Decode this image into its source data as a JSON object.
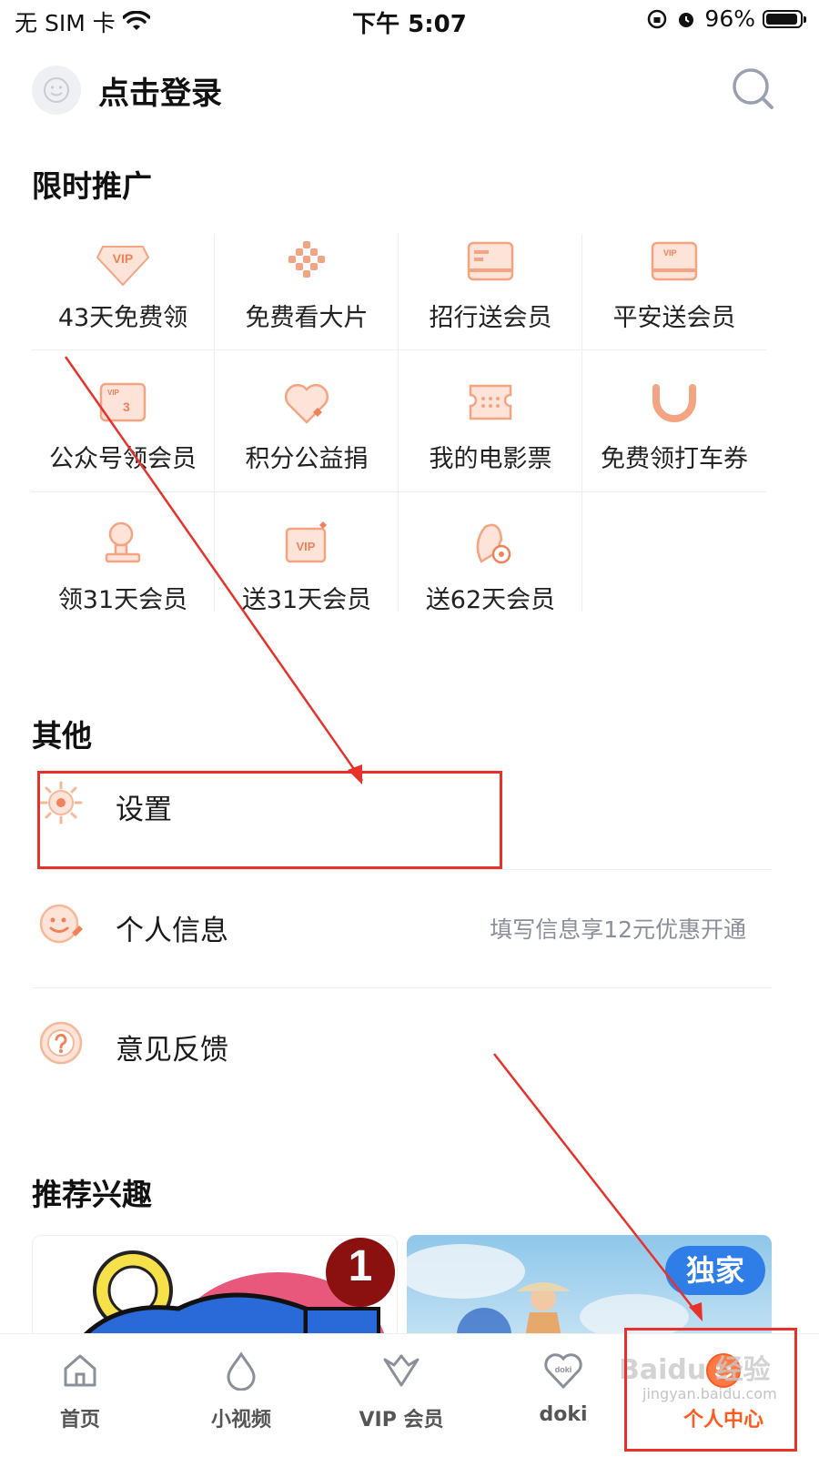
{
  "status_bar": {
    "carrier": "无 SIM 卡",
    "time": "下午 5:07",
    "battery": "96%",
    "battery_level": 0.96
  },
  "header": {
    "login_label": "点击登录"
  },
  "promo": {
    "title": "限时推广",
    "items": [
      {
        "label": "43天免费领",
        "icon": "vip-diamond-icon"
      },
      {
        "label": "免费看大片",
        "icon": "film-checker-icon"
      },
      {
        "label": "招行送会员",
        "icon": "card-icon"
      },
      {
        "label": "平安送会员",
        "icon": "vip-card-icon"
      },
      {
        "label": "公众号领会员",
        "icon": "vip-3-ticket-icon"
      },
      {
        "label": "积分公益捐",
        "icon": "heart-donate-icon"
      },
      {
        "label": "我的电影票",
        "icon": "movie-ticket-icon"
      },
      {
        "label": "免费领打车券",
        "icon": "didi-icon"
      },
      {
        "label": "领31天会员",
        "icon": "trophy-icon"
      },
      {
        "label": "送31天会员",
        "icon": "vip-gift-icon"
      },
      {
        "label": "送62天会员",
        "icon": "penguin-coin-icon"
      }
    ]
  },
  "other": {
    "title": "其他",
    "items": [
      {
        "label": "设置",
        "icon": "settings-gear-icon",
        "right": ""
      },
      {
        "label": "个人信息",
        "icon": "smile-wrench-icon",
        "right": "填写信息享12元优惠开通"
      },
      {
        "label": "意见反馈",
        "icon": "question-icon",
        "right": ""
      }
    ]
  },
  "recommend": {
    "title": "推荐兴趣",
    "badge": "1",
    "exclusive_tag": "独家"
  },
  "tabbar": {
    "items": [
      {
        "label": "首页",
        "icon": "home-icon"
      },
      {
        "label": "小视频",
        "icon": "droplet-icon"
      },
      {
        "label": "VIP 会员",
        "icon": "vip-crown-icon"
      },
      {
        "label": "doki",
        "icon": "doki-heart-icon"
      },
      {
        "label": "个人中心",
        "icon": "smile-face-icon"
      }
    ],
    "active": "个人中心"
  },
  "watermark": {
    "text": "Baidu 经验",
    "sub": "jingyan.baidu.com"
  },
  "colors": {
    "accent": "#ff5a1f",
    "icon_orange": "#f5a27e",
    "annotation_red": "#e8312a"
  }
}
